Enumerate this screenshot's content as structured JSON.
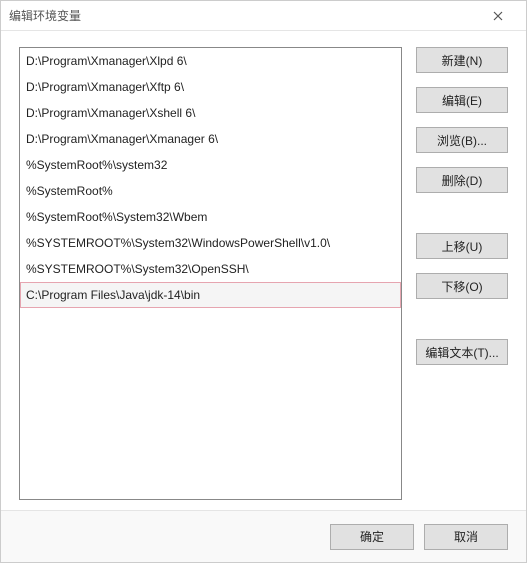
{
  "window": {
    "title": "编辑环境变量"
  },
  "list": {
    "items": [
      "D:\\Program\\Xmanager\\Xlpd 6\\",
      "D:\\Program\\Xmanager\\Xftp 6\\",
      "D:\\Program\\Xmanager\\Xshell 6\\",
      "D:\\Program\\Xmanager\\Xmanager 6\\",
      "%SystemRoot%\\system32",
      "%SystemRoot%",
      "%SystemRoot%\\System32\\Wbem",
      "%SYSTEMROOT%\\System32\\WindowsPowerShell\\v1.0\\",
      "%SYSTEMROOT%\\System32\\OpenSSH\\",
      "C:\\Program Files\\Java\\jdk-14\\bin"
    ],
    "selected_index": 9
  },
  "buttons": {
    "new": "新建(N)",
    "edit": "编辑(E)",
    "browse": "浏览(B)...",
    "delete": "删除(D)",
    "move_up": "上移(U)",
    "move_down": "下移(O)",
    "edit_text": "编辑文本(T)...",
    "ok": "确定",
    "cancel": "取消"
  }
}
